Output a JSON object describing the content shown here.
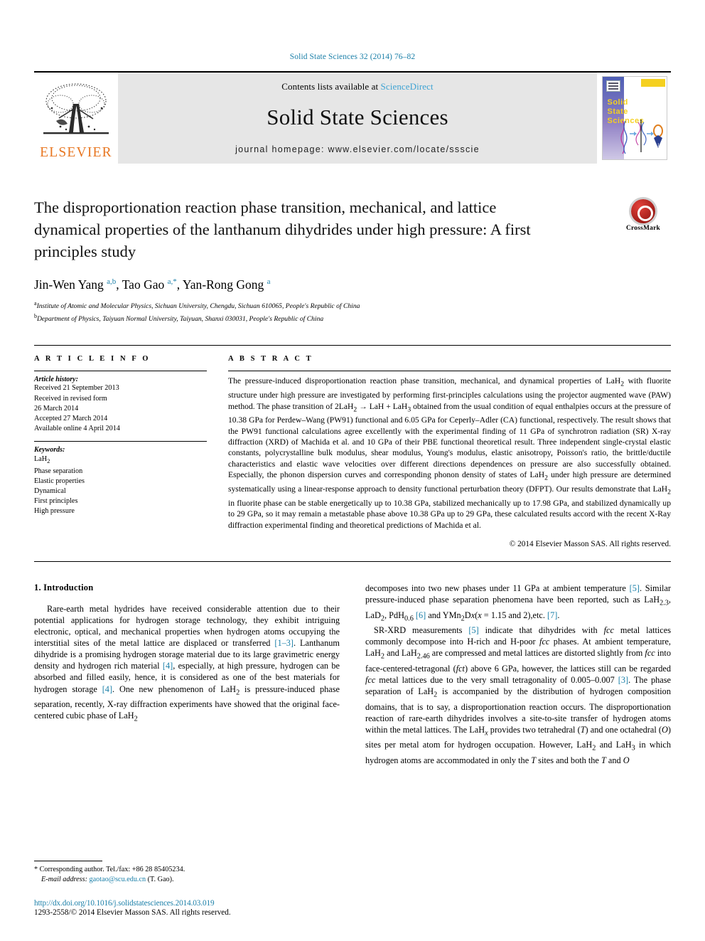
{
  "running_head": "Solid State Sciences 32 (2014) 76–82",
  "masthead": {
    "contents_prefix": "Contents lists available at ",
    "sciencedirect": "ScienceDirect",
    "journal_title": "Solid State Sciences",
    "homepage": "journal homepage: www.elsevier.com/locate/ssscie",
    "publisher_word": "ELSEVIER",
    "cover_title": "Solid\nState\nSciences",
    "accent_link_color": "#3ea3d3",
    "elsevier_orange": "#e87722"
  },
  "article": {
    "title": "The disproportionation reaction phase transition, mechanical, and lattice dynamical properties of the lanthanum dihydrides under high pressure: A first principles study",
    "crossmark_label": "CrossMark",
    "authors_html": "Jin-Wen Yang <sup>a,b</sup>, Tao Gao <sup>a,*</sup>, Yan-Rong Gong <sup>a</sup>",
    "affiliations": [
      {
        "marker": "a",
        "text": "Institute of Atomic and Molecular Physics, Sichuan University, Chengdu, Sichuan 610065, People's Republic of China"
      },
      {
        "marker": "b",
        "text": "Department of Physics, Taiyuan Normal University, Taiyuan, Shanxi 030031, People's Republic of China"
      }
    ]
  },
  "article_info": {
    "heading": "A R T I C L E   I N F O",
    "history_label": "Article history:",
    "history": [
      "Received 21 September 2013",
      "Received in revised form",
      "26 March 2014",
      "Accepted 27 March 2014",
      "Available online 4 April 2014"
    ],
    "keywords_label": "Keywords:",
    "keywords_html": [
      "LaH<sub>2</sub>",
      "Phase separation",
      "Elastic properties",
      "Dynamical",
      "First principles",
      "High pressure"
    ]
  },
  "abstract": {
    "heading": "A B S T R A C T",
    "text_html": "The pressure-induced disproportionation reaction phase transition, mechanical, and dynamical properties of LaH<sub>2</sub> with fluorite structure under high pressure are investigated by performing first-principles calculations using the projector augmented wave (PAW) method. The phase transition of 2LaH<sub>2</sub> &rarr; LaH + LaH<sub>3</sub> obtained from the usual condition of equal enthalpies occurs at the pressure of 10.38 GPa for Perdew&ndash;Wang (PW91) functional and 6.05 GPa for Ceperly&ndash;Adler (CA) functional, respectively. The result shows that the PW91 functional calculations agree excellently with the experimental finding of 11 GPa of synchrotron radiation (SR) X-ray diffraction (XRD) of Machida et al. and 10 GPa of their PBE functional theoretical result. Three independent single-crystal elastic constants, polycrystalline bulk modulus, shear modulus, Young's modulus, elastic anisotropy, Poisson's ratio, the brittle/ductile characteristics and elastic wave velocities over different directions dependences on pressure are also successfully obtained. Especially, the phonon dispersion curves and corresponding phonon density of states of LaH<sub>2</sub> under high pressure are determined systematically using a linear-response approach to density functional perturbation theory (DFPT). Our results demonstrate that LaH<sub>2</sub> in fluorite phase can be stable energetically up to 10.38 GPa, stabilized mechanically up to 17.98 GPa, and stabilized dynamically up to 29 GPa, so it may remain a metastable phase above 10.38 GPa up to 29 GPa, these calculated results accord with the recent X-Ray diffraction experimental finding and theoretical predictions of Machida et al.",
    "copyright": "© 2014 Elsevier Masson SAS. All rights reserved."
  },
  "body": {
    "section_title": "1. Introduction",
    "left_paragraph_html": "Rare-earth metal hydrides have received considerable attention due to their potential applications for hydrogen storage technology, they exhibit intriguing electronic, optical, and mechanical properties when hydrogen atoms occupying the interstitial sites of the metal lattice are displaced or transferred <span class=\"ref\">[1&ndash;3]</span>. Lanthanum dihydride is a promising hydrogen storage material due to its large gravimetric energy density and hydrogen rich material <span class=\"ref\">[4]</span>, especially, at high pressure, hydrogen can be absorbed and filled easily, hence, it is considered as one of the best materials for hydrogen storage <span class=\"ref\">[4]</span>. One new phenomenon of LaH<sub>2</sub> is pressure-induced phase separation, recently, X-ray diffraction experiments have showed that the original face-centered cubic phase of LaH<sub>2</sub>",
    "right_paragraph_1_html": "decomposes into two new phases under 11 GPa at ambient temperature <span class=\"ref\">[5]</span>. Similar pressure-induced phase separation phenomena have been reported, such as LaH<sub>2.3</sub>, LaD<sub>2</sub>, PdH<sub>0.6</sub> <span class=\"ref\">[6]</span> and YMn<sub>2</sub>D<i>x</i>(<i>x</i> = 1.15 and 2),etc. <span class=\"ref\">[7]</span>.",
    "right_paragraph_2_html": "SR-XRD measurements <span class=\"ref\">[5]</span> indicate that dihydrides with <i>fcc</i> metal lattices commonly decompose into H-rich and H-poor <i>fcc</i> phases. At ambient temperature, LaH<sub>2</sub> and LaH<sub>2.46</sub> are compressed and metal lattices are distorted slightly from <i>fcc</i> into face-centered-tetragonal (<i>fct</i>) above 6 GPa, however, the lattices still can be regarded <i>fcc</i> metal lattices due to the very small tetragonality of 0.005&ndash;0.007 <span class=\"ref\">[3]</span>. The phase separation of LaH<sub>2</sub> is accompanied by the distribution of hydrogen composition domains, that is to say, a disproportionation reaction occurs. The disproportionation reaction of rare-earth dihydrides involves a site-to-site transfer of hydrogen atoms within the metal lattices. The LaH<sub><i>x</i></sub> provides two tetrahedral (<i>T</i>) and one octahedral (<i>O</i>) sites per metal atom for hydrogen occupation. However, LaH<sub>2</sub> and LaH<sub>3</sub> in which hydrogen atoms are accommodated in only the <i>T</i> sites and both the <i>T</i> and <i>O</i>"
  },
  "footer": {
    "corresponding_html": "* Corresponding author. Tel./fax: +86 28 85405234.",
    "email_html": "<i>E-mail address:</i> <span class=\"ref\">gaotao@scu.edu.cn</span> (T. Gao).",
    "doi": "http://dx.doi.org/10.1016/j.solidstatesciences.2014.03.019",
    "issn_line": "1293-2558/© 2014 Elsevier Masson SAS. All rights reserved."
  }
}
